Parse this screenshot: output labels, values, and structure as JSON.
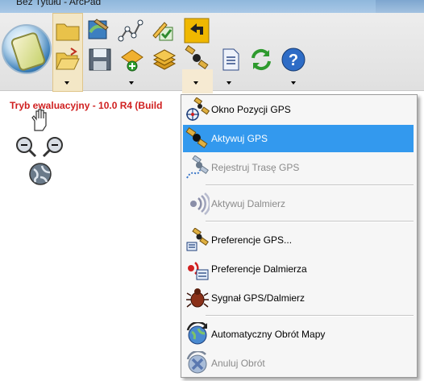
{
  "window": {
    "title": "Bez Tytułu - ArcPad"
  },
  "status": {
    "evaluation_text": "Tryb ewaluacyjny - 10.0 R4 (Build"
  },
  "toolbar": {
    "row1": [
      {
        "name": "folder-icon"
      },
      {
        "name": "map-pencil-icon"
      },
      {
        "name": "edit-vertices-icon"
      },
      {
        "name": "checkbox-edit-icon"
      },
      {
        "name": "back-arrow-icon"
      }
    ],
    "row2": [
      {
        "name": "open-folder-icon"
      },
      {
        "name": "save-icon"
      },
      {
        "name": "add-layer-icon"
      },
      {
        "name": "layers-icon"
      },
      {
        "name": "gps-satellite-icon"
      },
      {
        "name": "document-icon"
      },
      {
        "name": "refresh-icon"
      },
      {
        "name": "help-icon"
      }
    ]
  },
  "map_tools": [
    {
      "name": "pan-hand-icon"
    },
    {
      "name": "zoom-out-icon"
    },
    {
      "name": "zoom-in-icon"
    },
    {
      "name": "globe-icon"
    }
  ],
  "gps_menu": {
    "items": [
      {
        "label": "Okno Pozycji GPS",
        "icon": "gps-position-window-icon",
        "enabled": true,
        "active": false
      },
      {
        "label": "Aktywuj GPS",
        "icon": "gps-activate-icon",
        "enabled": true,
        "active": true
      },
      {
        "label": "Rejestruj Trasę GPS",
        "icon": "gps-track-log-icon",
        "enabled": false,
        "active": false
      },
      {
        "label": "Aktywuj Dalmierz",
        "icon": "rangefinder-icon",
        "enabled": false,
        "active": false
      },
      {
        "label": "Preferencje GPS...",
        "icon": "gps-preferences-icon",
        "enabled": true,
        "active": false
      },
      {
        "label": "Preferencje Dalmierza",
        "icon": "rangefinder-preferences-icon",
        "enabled": true,
        "active": false
      },
      {
        "label": "Sygnał GPS/Dalmierz",
        "icon": "gps-signal-bug-icon",
        "enabled": true,
        "active": false
      },
      {
        "label": "Automatyczny Obrót Mapy",
        "icon": "auto-rotate-map-icon",
        "enabled": true,
        "active": false
      },
      {
        "label": "Anuluj Obrót",
        "icon": "cancel-rotation-icon",
        "enabled": false,
        "active": false
      }
    ]
  },
  "colors": {
    "highlight": "#3399ee",
    "evaluation_text": "#d02020",
    "disabled_text": "#8a8a8a"
  }
}
